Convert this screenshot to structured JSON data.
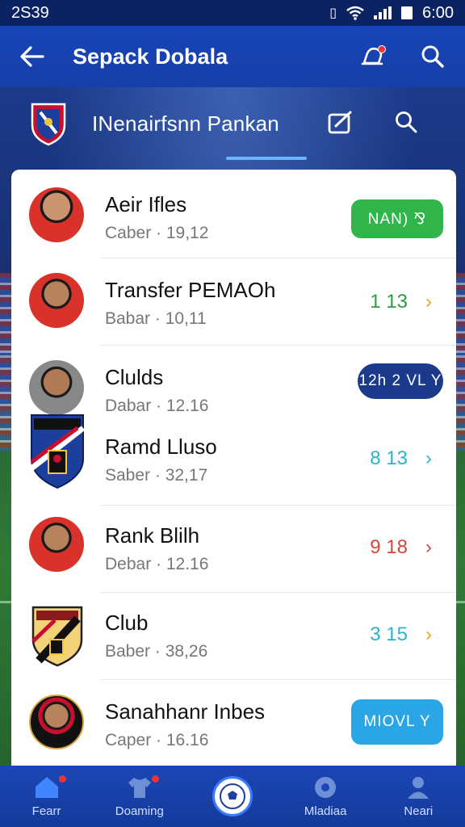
{
  "status_bar": {
    "left_text": "2S39",
    "time": "6:00"
  },
  "app_bar": {
    "title": "Sepack Dobala"
  },
  "sub_header": {
    "title": "INenairfsnn Pankan"
  },
  "rows": [
    {
      "name": "Aeir Ifles",
      "sub": "Caber · 19,12",
      "action_type": "pill",
      "action_label": "NAN) ⅋",
      "action_color": "#2fb54a"
    },
    {
      "name": "Transfer PEMAOh",
      "sub": "Babar · 10,11",
      "action_type": "score",
      "action_label": "1  13",
      "action_color": "#2e9b48",
      "chevron_color": "#f0a023"
    },
    {
      "name": "Clulds",
      "sub": "Dabar · 12.16",
      "action_type": "pill",
      "action_label": "12h 2 VL Y",
      "action_color": "#1b3a8c"
    },
    {
      "name": "Ramd Lluso",
      "sub": "Saber · 32,17",
      "action_type": "score",
      "action_label": "8  13",
      "action_color": "#2bb3c8",
      "chevron_color": "#2bb3c8"
    },
    {
      "name": "Rank Blilh",
      "sub": "Debar · 12.16",
      "action_type": "score",
      "action_label": "9  18",
      "action_color": "#d9463d",
      "chevron_color": "#d9463d"
    },
    {
      "name": "Club",
      "sub": "Baber · 38,26",
      "action_type": "score",
      "action_label": "3  15",
      "action_color": "#2bb3c8",
      "chevron_color": "#f0a023"
    },
    {
      "name": "Sanahhanr Inbes",
      "sub": "Caper · 16.16",
      "action_type": "pill",
      "action_label": "MIOVL Y",
      "action_color": "#2aa6e6"
    }
  ],
  "bottom_nav": [
    {
      "label": "Fearr"
    },
    {
      "label": "Doaming"
    },
    {
      "label": ""
    },
    {
      "label": "Mladiaa"
    },
    {
      "label": "Neari"
    }
  ]
}
